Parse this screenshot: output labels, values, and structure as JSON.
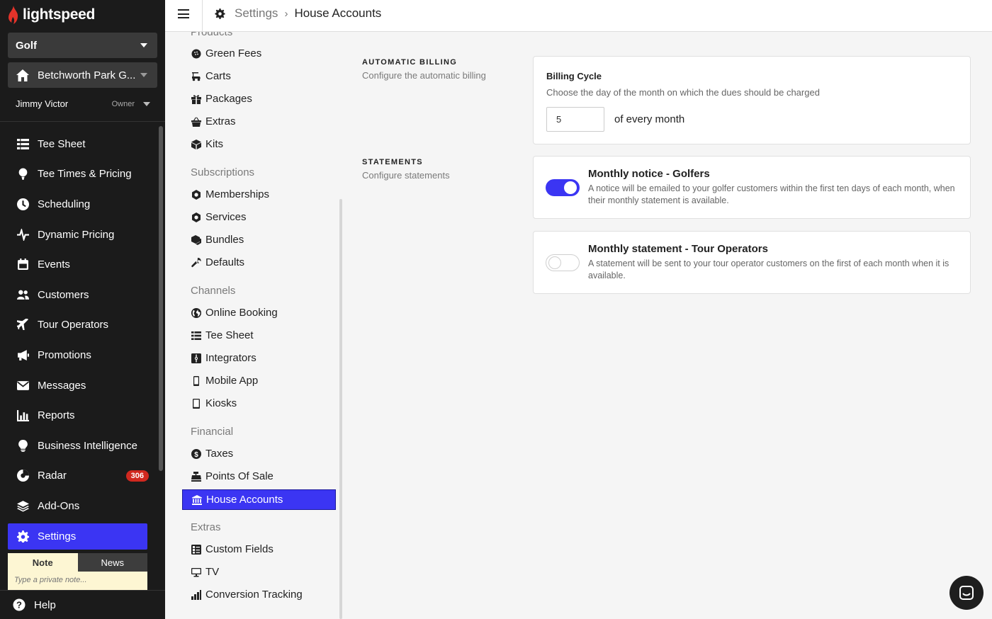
{
  "brand": {
    "name": "lightspeed",
    "accent": "#3b35f3",
    "flame_color": "#e4332a"
  },
  "sidebar": {
    "business_select": "Golf",
    "course_select": "Betchworth Park G...",
    "user": {
      "name": "Jimmy Victor",
      "role": "Owner"
    },
    "items": [
      {
        "label": "Tee Sheet",
        "icon": "list-icon"
      },
      {
        "label": "Tee Times & Pricing",
        "icon": "golf-ball-tee-icon"
      },
      {
        "label": "Scheduling",
        "icon": "clock-icon"
      },
      {
        "label": "Dynamic Pricing",
        "icon": "pulse-icon"
      },
      {
        "label": "Events",
        "icon": "calendar-icon"
      },
      {
        "label": "Customers",
        "icon": "users-icon"
      },
      {
        "label": "Tour Operators",
        "icon": "plane-icon"
      },
      {
        "label": "Promotions",
        "icon": "megaphone-icon"
      },
      {
        "label": "Messages",
        "icon": "envelope-icon"
      },
      {
        "label": "Reports",
        "icon": "bar-chart-icon"
      },
      {
        "label": "Business Intelligence",
        "icon": "lightbulb-icon"
      },
      {
        "label": "Radar",
        "icon": "radar-icon",
        "badge": "306"
      },
      {
        "label": "Add-Ons",
        "icon": "layers-icon"
      },
      {
        "label": "Settings",
        "icon": "gear-icon",
        "active": true
      }
    ],
    "note": {
      "tab_note": "Note",
      "tab_news": "News",
      "placeholder": "Type a private note..."
    },
    "help": "Help"
  },
  "topbar": {
    "breadcrumb_root": "Settings",
    "breadcrumb_current": "House Accounts"
  },
  "subnav": {
    "groups": [
      {
        "title": "Products",
        "items": [
          "Green Fees",
          "Carts",
          "Packages",
          "Extras",
          "Kits"
        ]
      },
      {
        "title": "Subscriptions",
        "items": [
          "Memberships",
          "Services",
          "Bundles",
          "Defaults"
        ]
      },
      {
        "title": "Channels",
        "items": [
          "Online Booking",
          "Tee Sheet",
          "Integrators",
          "Mobile App",
          "Kiosks"
        ]
      },
      {
        "title": "Financial",
        "items": [
          "Taxes",
          "Points Of Sale",
          "House Accounts"
        ]
      },
      {
        "title": "Extras",
        "items": [
          "Custom Fields",
          "TV",
          "Conversion Tracking"
        ]
      }
    ],
    "active": "House Accounts"
  },
  "main": {
    "automatic_billing": {
      "title": "AUTOMATIC BILLING",
      "desc": "Configure the automatic billing",
      "card_title": "Billing Cycle",
      "card_desc": "Choose the day of the month on which the dues should be charged",
      "day_value": "5",
      "suffix": "of every month"
    },
    "statements": {
      "title": "STATEMENTS",
      "desc": "Configure statements",
      "golfers": {
        "title": "Monthly notice - Golfers",
        "desc": "A notice will be emailed to your golfer customers within the first ten days of each month, when their monthly statement is available.",
        "enabled": true
      },
      "tour_operators": {
        "title": "Monthly statement - Tour Operators",
        "desc": "A statement will be sent to your tour operator customers on the first of each month when it is available.",
        "enabled": false
      }
    }
  }
}
